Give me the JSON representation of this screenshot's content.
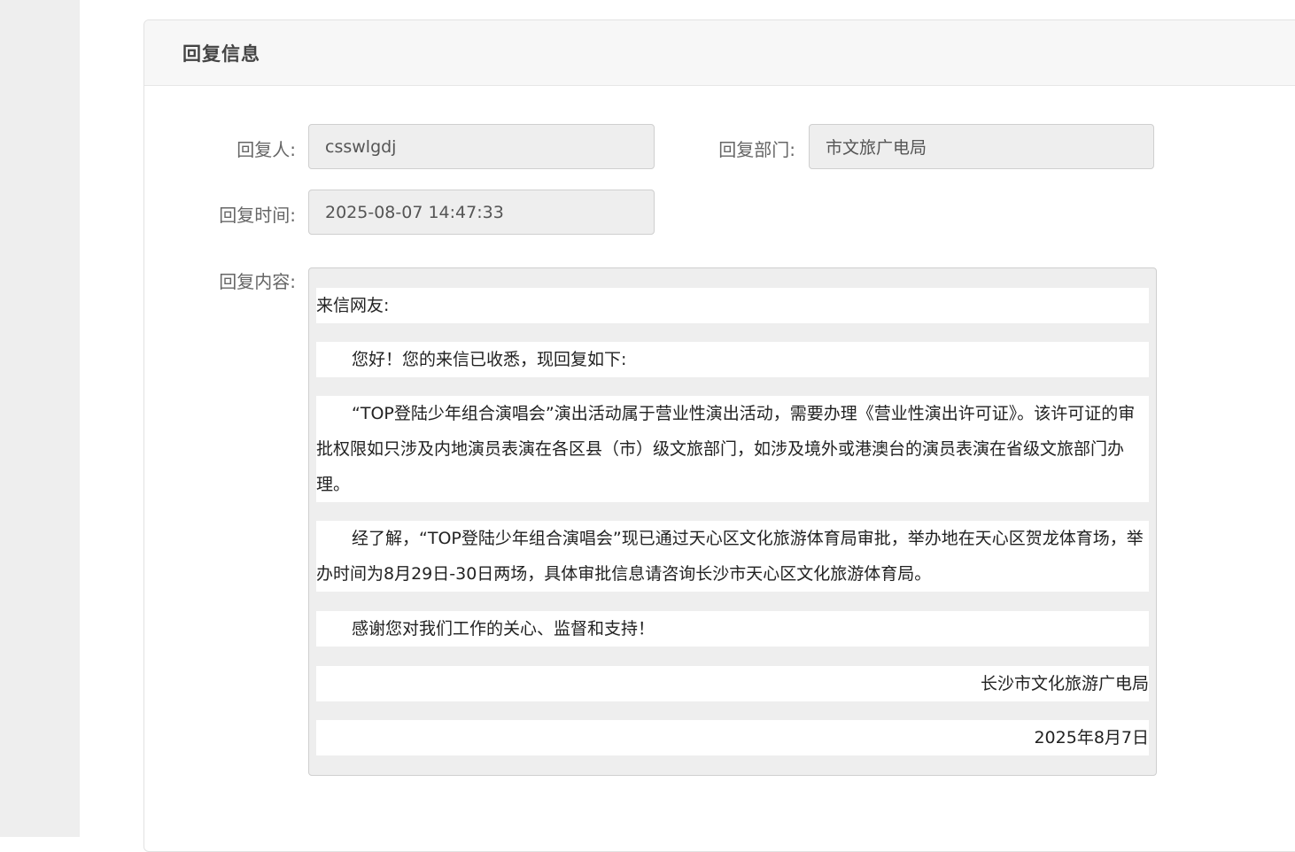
{
  "panel": {
    "title": "回复信息"
  },
  "fields": {
    "replier_label": "回复人:",
    "replier_value": "csswlgdj",
    "department_label": "回复部门:",
    "department_value": "市文旅广电局",
    "time_label": "回复时间:",
    "time_value": "2025-08-07 14:47:33",
    "content_label": "回复内容:"
  },
  "content": {
    "greeting": "来信网友:",
    "p1": "您好！您的来信已收悉，现回复如下:",
    "p2": "“TOP登陆少年组合演唱会”演出活动属于营业性演出活动，需要办理《营业性演出许可证》。该许可证的审批权限如只涉及内地演员表演在各区县（市）级文旅部门，如涉及境外或港澳台的演员表演在省级文旅部门办理。",
    "p3": "经了解，“TOP登陆少年组合演唱会”现已通过天心区文化旅游体育局审批，举办地在天心区贺龙体育场，举办时间为8月29日-30日两场，具体审批信息请咨询长沙市天心区文化旅游体育局。",
    "p4": "感谢您对我们工作的关心、监督和支持！",
    "signature": "长沙市文化旅游广电局",
    "date": "2025年8月7日"
  }
}
